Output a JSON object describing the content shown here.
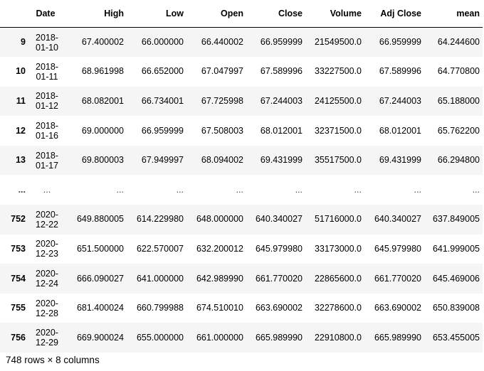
{
  "table": {
    "columns": [
      "Date",
      "High",
      "Low",
      "Open",
      "Close",
      "Volume",
      "Adj Close",
      "mean"
    ],
    "rows": [
      {
        "index": "9",
        "date": [
          "2018-",
          "01-10"
        ],
        "cells": [
          "67.400002",
          "66.000000",
          "66.440002",
          "66.959999",
          "21549500.0",
          "66.959999",
          "64.244600"
        ]
      },
      {
        "index": "10",
        "date": [
          "2018-",
          "01-11"
        ],
        "cells": [
          "68.961998",
          "66.652000",
          "67.047997",
          "67.589996",
          "33227500.0",
          "67.589996",
          "64.770800"
        ]
      },
      {
        "index": "11",
        "date": [
          "2018-",
          "01-12"
        ],
        "cells": [
          "68.082001",
          "66.734001",
          "67.725998",
          "67.244003",
          "24125500.0",
          "67.244003",
          "65.188000"
        ]
      },
      {
        "index": "12",
        "date": [
          "2018-",
          "01-16"
        ],
        "cells": [
          "69.000000",
          "66.959999",
          "67.508003",
          "68.012001",
          "32371500.0",
          "68.012001",
          "65.762200"
        ]
      },
      {
        "index": "13",
        "date": [
          "2018-",
          "01-17"
        ],
        "cells": [
          "69.800003",
          "67.949997",
          "68.094002",
          "69.431999",
          "35517500.0",
          "69.431999",
          "66.294800"
        ]
      },
      {
        "index": "...",
        "date": [
          "..."
        ],
        "cells": [
          "...",
          "...",
          "...",
          "...",
          "...",
          "...",
          "..."
        ]
      },
      {
        "index": "752",
        "date": [
          "2020-",
          "12-22"
        ],
        "cells": [
          "649.880005",
          "614.229980",
          "648.000000",
          "640.340027",
          "51716000.0",
          "640.340027",
          "637.849005"
        ]
      },
      {
        "index": "753",
        "date": [
          "2020-",
          "12-23"
        ],
        "cells": [
          "651.500000",
          "622.570007",
          "632.200012",
          "645.979980",
          "33173000.0",
          "645.979980",
          "641.999005"
        ]
      },
      {
        "index": "754",
        "date": [
          "2020-",
          "12-24"
        ],
        "cells": [
          "666.090027",
          "641.000000",
          "642.989990",
          "661.770020",
          "22865600.0",
          "661.770020",
          "645.469006"
        ]
      },
      {
        "index": "755",
        "date": [
          "2020-",
          "12-28"
        ],
        "cells": [
          "681.400024",
          "660.799988",
          "674.510010",
          "663.690002",
          "32278600.0",
          "663.690002",
          "650.839008"
        ]
      },
      {
        "index": "756",
        "date": [
          "2020-",
          "12-29"
        ],
        "cells": [
          "669.900024",
          "655.000000",
          "661.000000",
          "665.989990",
          "22910800.0",
          "665.989990",
          "653.455005"
        ]
      }
    ]
  },
  "footer": {
    "text": "748 rows × 8 columns"
  }
}
